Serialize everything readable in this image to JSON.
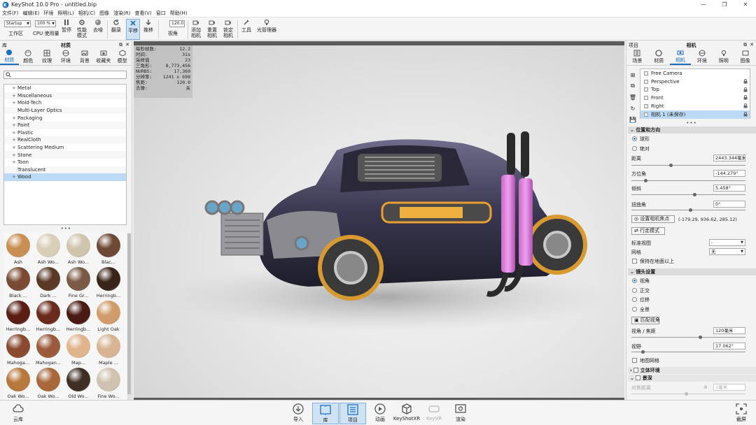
{
  "window": {
    "title": "KeyShot 10.0 Pro  - untitled.bip"
  },
  "menu": [
    "文件(F)",
    "编辑(E)",
    "环境",
    "照明(L)",
    "相机(C)",
    "图像",
    "渲染(R)",
    "查看(V)",
    "窗口",
    "帮助(H)"
  ],
  "toolbar": {
    "workspace_value": "Startup",
    "workspace_label": "工作区",
    "cpu_value": "100 %",
    "cpu_label": "CPU 使用量",
    "pause": "暂停",
    "perf_mode": "性能模式",
    "denoise": "去噪",
    "refresh": "翻录",
    "pan": "平移",
    "dolly": "推移",
    "fov_value": "120.0",
    "fov_label": "视角",
    "add_camera": "添加相机",
    "reset_camera": "重置相机",
    "lock_camera": "锁定相机",
    "tools": "工具",
    "light_manager": "光管理器"
  },
  "library": {
    "panel_left": "库",
    "panel_title": "材质",
    "tabs": [
      "材质",
      "颜色",
      "纹理",
      "环境",
      "背景",
      "收藏夹",
      "模型"
    ],
    "tree": [
      {
        "label": "Metal",
        "plus": true
      },
      {
        "label": "Miscellaneous",
        "plus": true
      },
      {
        "label": "Mold-Tech",
        "plus": true
      },
      {
        "label": "Multi-Layer Optics",
        "plus": false
      },
      {
        "label": "Packaging",
        "plus": true
      },
      {
        "label": "Paint",
        "plus": true
      },
      {
        "label": "Plastic",
        "plus": true
      },
      {
        "label": "RealCloth",
        "plus": true
      },
      {
        "label": "Scattering Medium",
        "plus": true
      },
      {
        "label": "Stone",
        "plus": true
      },
      {
        "label": "Toon",
        "plus": true
      },
      {
        "label": "Translucent",
        "plus": false
      },
      {
        "label": "Wood",
        "plus": true,
        "selected": true
      }
    ],
    "materials": [
      {
        "name": "Ash",
        "color": "#c98e52"
      },
      {
        "name": "Ash Wo...",
        "color": "#d9cfb8"
      },
      {
        "name": "Ash Wo...",
        "color": "#cfc4ac"
      },
      {
        "name": "Blac...",
        "color": "#6e4a36"
      },
      {
        "name": "Black ...",
        "color": "#7a4b32"
      },
      {
        "name": "Dark ...",
        "color": "#5a3a26"
      },
      {
        "name": "Fine Gr...",
        "color": "#7a5a44"
      },
      {
        "name": "Herringb...",
        "color": "#3a2418"
      },
      {
        "name": "Herringb...",
        "color": "#5a1e14"
      },
      {
        "name": "Herringb...",
        "color": "#6a2a1c"
      },
      {
        "name": "Herringb...",
        "color": "#4a1a12"
      },
      {
        "name": "Light Oak",
        "color": "#d19c6a"
      },
      {
        "name": "Mahoga...",
        "color": "#8a4a30"
      },
      {
        "name": "Mahogan...",
        "color": "#9c5a3c"
      },
      {
        "name": "Map...",
        "color": "#e0b48c"
      },
      {
        "name": "Maple ...",
        "color": "#d8b494"
      },
      {
        "name": "Oak Wo...",
        "color": "#b8783c"
      },
      {
        "name": "Oak Wo...",
        "color": "#a8683a"
      },
      {
        "name": "Old Wo...",
        "color": "#3e2e24"
      },
      {
        "name": "Fine Wo...",
        "color": "#cfc2b0"
      },
      {
        "name": "",
        "color": "#e2d2b4"
      },
      {
        "name": "",
        "color": "#a0542c"
      },
      {
        "name": "",
        "color": "#3a2218"
      }
    ]
  },
  "hud": [
    {
      "k": "每秒帧数:",
      "v": "12.2"
    },
    {
      "k": "时间:",
      "v": "31s"
    },
    {
      "k": "采样值",
      "v": "23"
    },
    {
      "k": "三角形:",
      "v": "8,773,456"
    },
    {
      "k": "NURBS:",
      "v": "17,369"
    },
    {
      "k": "分辨率:",
      "v": "1241 x 698"
    },
    {
      "k": "焦距:",
      "v": "120.0"
    },
    {
      "k": "去噪:",
      "v": "关"
    }
  ],
  "project": {
    "panel_left": "项目",
    "panel_title": "相机",
    "tabs": [
      "场景",
      "材质",
      "相机",
      "环境",
      "照明",
      "图像"
    ],
    "cameras": [
      {
        "name": "Free Camera",
        "lock": false
      },
      {
        "name": "Perspective",
        "lock": true
      },
      {
        "name": "Top",
        "lock": true
      },
      {
        "name": "Front",
        "lock": true
      },
      {
        "name": "Right",
        "lock": true
      },
      {
        "name": "相机 1 (未保存)",
        "lock": true,
        "selected": true
      }
    ],
    "pos_section": "位置和方向",
    "radio_sphere": "球形",
    "radio_absolute": "绝对",
    "distance_label": "距离",
    "distance_value": "2443.344毫米",
    "azimuth_label": "方位角",
    "azimuth_value": "-144.279°",
    "incline_label": "倾斜",
    "incline_value": "5.458°",
    "twist_label": "扭曲角",
    "twist_value": "0°",
    "focus_btn": "设置相机焦点",
    "focus_coords": "(-179.29, 936.62, 285.12)",
    "walk_btn": "行走模式",
    "stdview_label": "标准视图",
    "stdview_value": "-",
    "grid_label": "网格",
    "grid_value": "无",
    "above_ground": "保持在地面以上",
    "lens_section": "镜头设置",
    "lens_perspective": "视角",
    "lens_ortho": "正交",
    "lens_shift": "位移",
    "lens_pano": "全景",
    "match_btn": "匹配视角",
    "fov_label": "视角 / 焦距",
    "fov_value": "120毫米",
    "fieldview_label": "视野",
    "fieldview_value": "17.062°",
    "guide_grid": "地图网格",
    "stereo_section": "立体环境",
    "dof_section": "景深",
    "focus_distance": "对焦距离",
    "focus_value": "1毫米"
  },
  "bottom": {
    "cloud": "云库",
    "import": "导入",
    "library": "库",
    "project": "项目",
    "animation": "动画",
    "keyshotxr": "KeyShotXR",
    "keyvr": "KeyVR",
    "render": "渲染",
    "screenshot": "截屏"
  }
}
